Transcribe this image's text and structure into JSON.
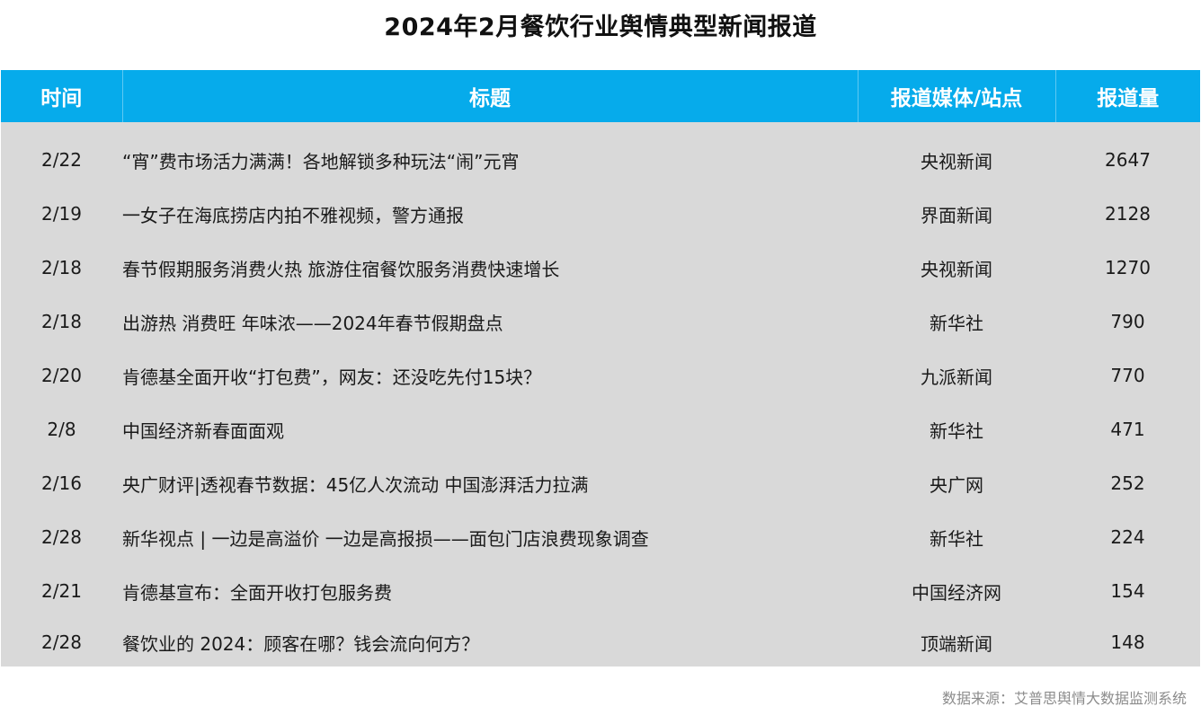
{
  "title": "2024年2月餐饮行业舆情典型新闻报道",
  "table": {
    "headers": {
      "date": "时间",
      "title": "标题",
      "media": "报道媒体/站点",
      "count": "报道量"
    },
    "rows": [
      {
        "date": "2/22",
        "title": "“宵”费市场活力满满！各地解锁多种玩法“闹”元宵",
        "media": "央视新闻",
        "count": "2647"
      },
      {
        "date": "2/19",
        "title": "一女子在海底捞店内拍不雅视频，警方通报",
        "media": "界面新闻",
        "count": "2128"
      },
      {
        "date": "2/18",
        "title": "春节假期服务消费火热 旅游住宿餐饮服务消费快速增长",
        "media": "央视新闻",
        "count": "1270"
      },
      {
        "date": "2/18",
        "title": "出游热 消费旺 年味浓——2024年春节假期盘点",
        "media": "新华社",
        "count": "790"
      },
      {
        "date": "2/20",
        "title": "肯德基全面开收“打包费”，网友：还没吃先付15块？",
        "media": "九派新闻",
        "count": "770"
      },
      {
        "date": "2/8",
        "title": "中国经济新春面面观",
        "media": "新华社",
        "count": "471"
      },
      {
        "date": "2/16",
        "title": "央广财评|透视春节数据：45亿人次流动 中国澎湃活力拉满",
        "media": "央广网",
        "count": "252"
      },
      {
        "date": "2/28",
        "title": "新华视点 | 一边是高溢价 一边是高报损——面包门店浪费现象调查",
        "media": "新华社",
        "count": "224"
      },
      {
        "date": "2/21",
        "title": "肯德基宣布：全面开收打包服务费",
        "media": "中国经济网",
        "count": "154"
      },
      {
        "date": "2/28",
        "title": "餐饮业的 2024：顾客在哪？钱会流向何方？",
        "media": "顶端新闻",
        "count": "148"
      }
    ]
  },
  "source": "数据来源：艾普思舆情大数据监测系统",
  "colors": {
    "header_bg": "#06ABEB",
    "body_bg": "#D9D9D9"
  }
}
